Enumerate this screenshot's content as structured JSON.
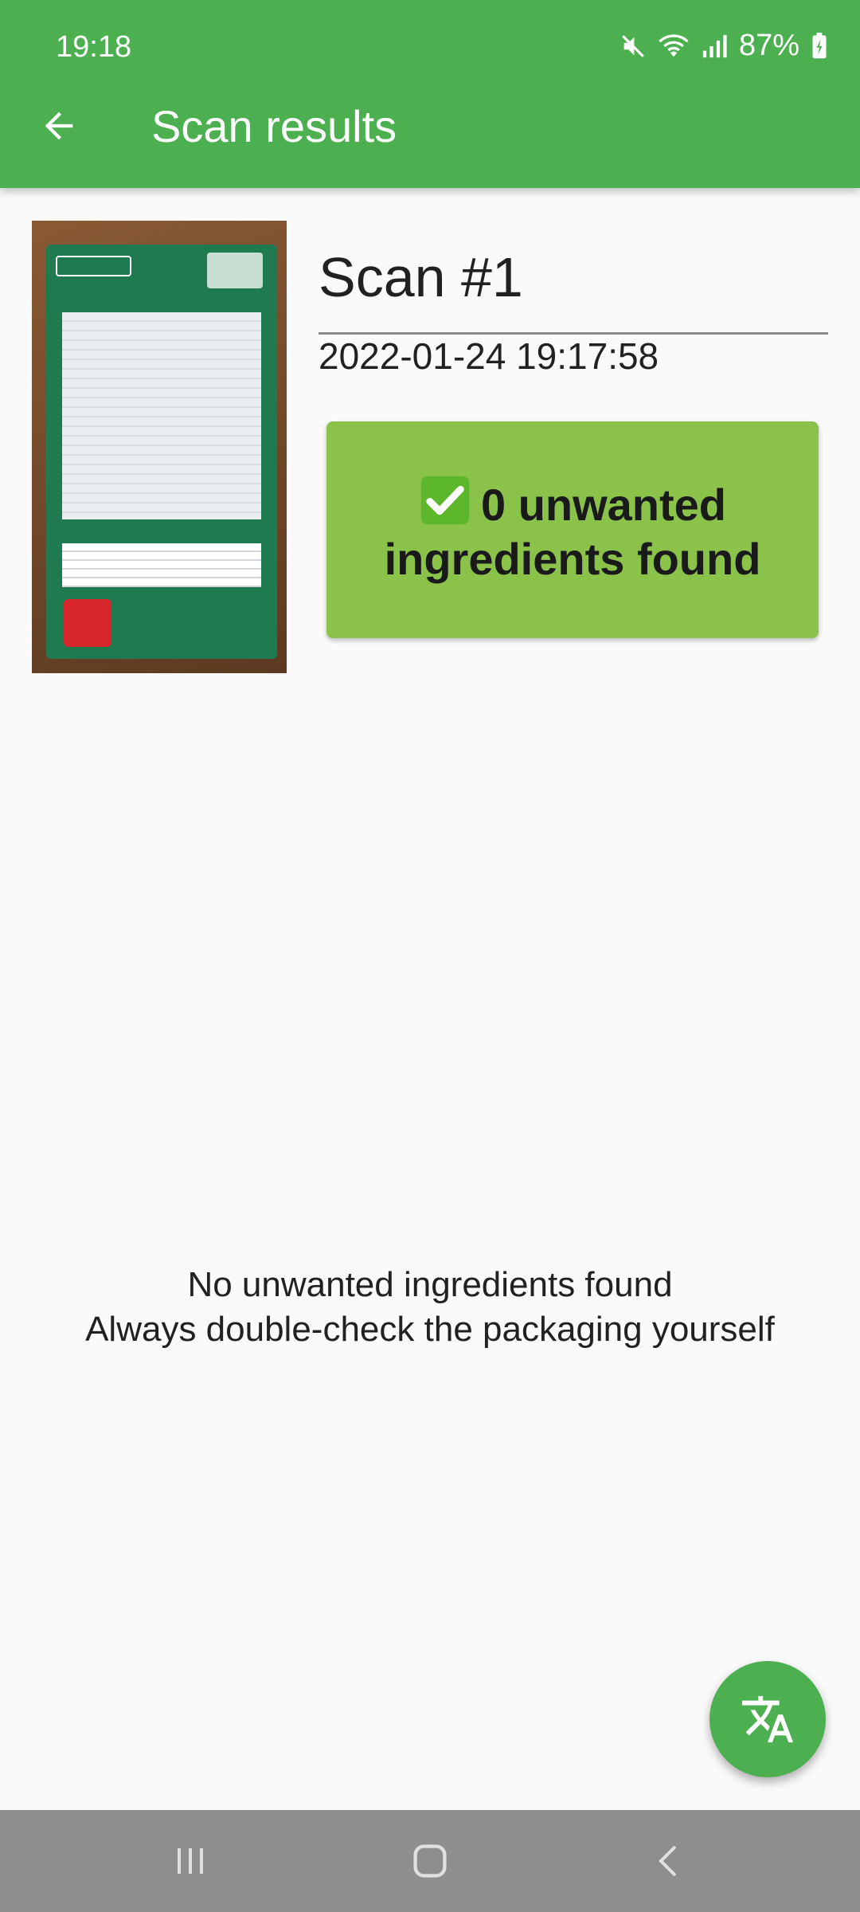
{
  "status_bar": {
    "time": "19:18",
    "battery": "87%",
    "icons": [
      "mute-icon",
      "wifi-icon",
      "signal-icon",
      "battery-charging-icon"
    ]
  },
  "appbar": {
    "title": "Scan results",
    "back_icon": "arrow-back-icon",
    "color": "#4caf50"
  },
  "scan": {
    "title": "Scan #1",
    "datetime": "2022-01-24 19:17:58",
    "image": "product-package-photo"
  },
  "result_card": {
    "icon": "check-mark-icon",
    "text": "0 unwanted ingredients found",
    "color": "#8bc34a"
  },
  "message": {
    "line1": "No unwanted ingredients found",
    "line2": "Always double-check the packaging yourself"
  },
  "fab": {
    "icon": "translate-icon",
    "color": "#4caf50"
  },
  "navigation": {
    "items": [
      "recent-apps-icon",
      "home-icon",
      "back-icon"
    ]
  }
}
